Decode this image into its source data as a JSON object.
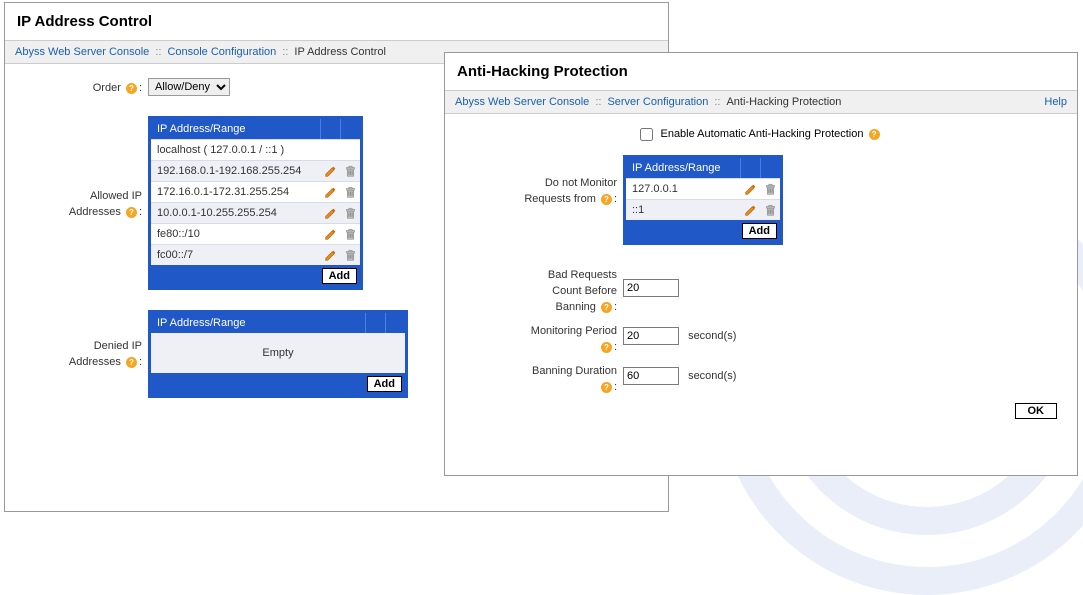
{
  "panel1": {
    "title": "IP Address Control",
    "breadcrumb": {
      "items": [
        "Abyss Web Server Console",
        "Console Configuration",
        "IP Address Control"
      ],
      "sep": "::"
    },
    "order": {
      "label": "Order",
      "selected": "Allow/Deny"
    },
    "allowed": {
      "label_line1": "Allowed IP",
      "label_line2": "Addresses",
      "header": "IP Address/Range",
      "rows": [
        {
          "text": "localhost ( 127.0.0.1 / ::1 )",
          "edit": false,
          "del": false
        },
        {
          "text": "192.168.0.1-192.168.255.254",
          "edit": true,
          "del": true
        },
        {
          "text": "172.16.0.1-172.31.255.254",
          "edit": true,
          "del": true
        },
        {
          "text": "10.0.0.1-10.255.255.254",
          "edit": true,
          "del": true
        },
        {
          "text": "fe80::/10",
          "edit": true,
          "del": true
        },
        {
          "text": "fc00::/7",
          "edit": true,
          "del": true
        }
      ],
      "add": "Add"
    },
    "denied": {
      "label_line1": "Denied IP",
      "label_line2": "Addresses",
      "header": "IP Address/Range",
      "empty": "Empty",
      "add": "Add"
    }
  },
  "panel2": {
    "title": "Anti-Hacking Protection",
    "breadcrumb": {
      "items": [
        "Abyss Web Server Console",
        "Server Configuration",
        "Anti-Hacking Protection"
      ],
      "sep": "::",
      "help": "Help"
    },
    "enable": {
      "label": "Enable Automatic Anti-Hacking Protection",
      "checked": false
    },
    "monitor": {
      "label_line1": "Do not Monitor",
      "label_line2": "Requests from",
      "header": "IP Address/Range",
      "rows": [
        {
          "text": "127.0.0.1",
          "edit": true,
          "del": true
        },
        {
          "text": "::1",
          "edit": true,
          "del": true
        }
      ],
      "add": "Add"
    },
    "bad_requests": {
      "label_line1": "Bad Requests",
      "label_line2": "Count Before",
      "label_line3": "Banning",
      "value": "20"
    },
    "monitoring_period": {
      "label": "Monitoring Period",
      "value": "20",
      "unit": "second(s)"
    },
    "banning_duration": {
      "label": "Banning Duration",
      "value": "60",
      "unit": "second(s)"
    },
    "ok": "OK"
  },
  "glyph": {
    "help": "?"
  }
}
